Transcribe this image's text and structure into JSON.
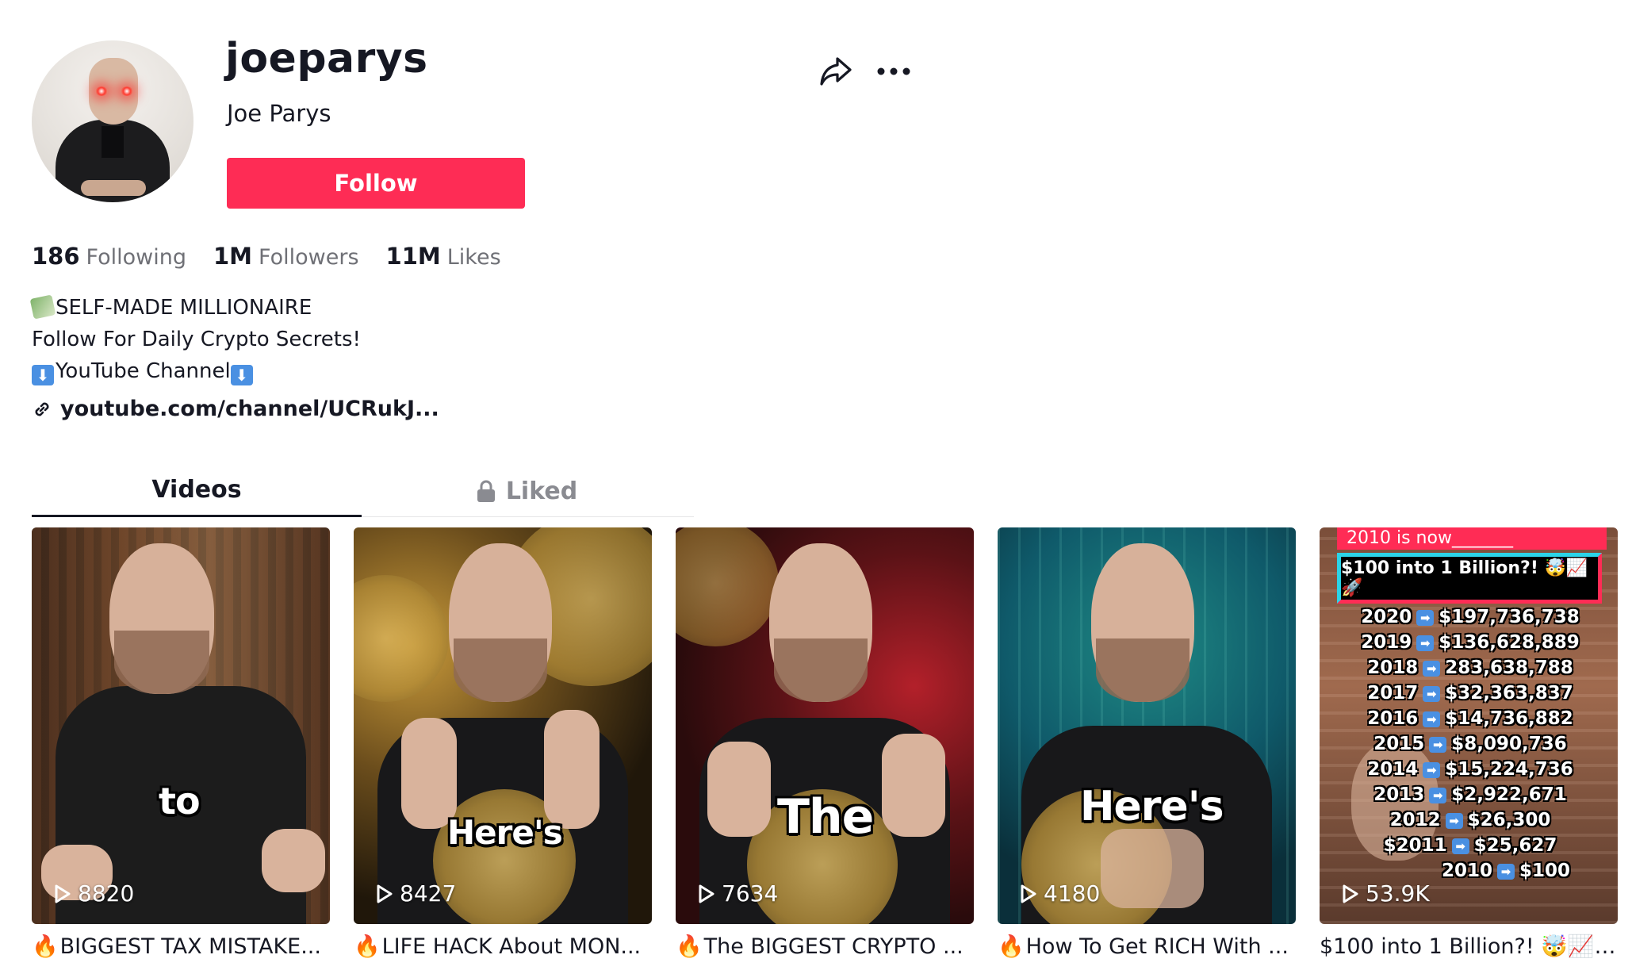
{
  "profile": {
    "username": "joeparys",
    "display_name": "Joe Parys",
    "follow_label": "Follow"
  },
  "stats": [
    {
      "value": "186",
      "label": "Following"
    },
    {
      "value": "1M",
      "label": "Followers"
    },
    {
      "value": "11M",
      "label": "Likes"
    }
  ],
  "bio": {
    "line1": "SELF-MADE MILLIONAIRE",
    "line2": "Follow For Daily Crypto Secrets!",
    "line3": "YouTube Channel",
    "link": "youtube.com/channel/UCRukJ..."
  },
  "tabs": {
    "videos": "Videos",
    "liked": "Liked"
  },
  "videos": [
    {
      "views": "8820",
      "title": "BIGGEST TAX MISTAKE...",
      "caption": "to"
    },
    {
      "views": "8427",
      "title": "LIFE HACK About MON...",
      "caption": "Here's"
    },
    {
      "views": "7634",
      "title": "The BIGGEST CRYPTO ...",
      "caption": "The"
    },
    {
      "views": "4180",
      "title": "How To Get RICH With ...",
      "caption": "Here's"
    },
    {
      "views": "53.9K",
      "title": "$100 into 1 Billion?! 🤯📈🚀...",
      "caption": ""
    }
  ],
  "video5_overlay": {
    "top_text": "2010 is now_______",
    "box_text": "$100 into 1 Billion?! 🤯📈🚀",
    "rows": [
      {
        "year": "2020",
        "amount": "$197,736,738"
      },
      {
        "year": "2019",
        "amount": "$136,628,889"
      },
      {
        "year": "2018",
        "amount": "283,638,788"
      },
      {
        "year": "2017",
        "amount": "$32,363,837"
      },
      {
        "year": "2016",
        "amount": "$14,736,882"
      },
      {
        "year": "2015",
        "amount": "$8,090,736"
      },
      {
        "year": "2014",
        "amount": "$15,224,736"
      },
      {
        "year": "2013",
        "amount": "$2,922,671"
      },
      {
        "year": "2012",
        "amount": "$26,300"
      },
      {
        "year": "$2011",
        "amount": "$25,627"
      },
      {
        "year": "2010",
        "amount": "$100"
      }
    ]
  },
  "colors": {
    "follow_button": "#fe2c55",
    "text_primary": "#161823",
    "text_secondary": "#6f7076"
  }
}
